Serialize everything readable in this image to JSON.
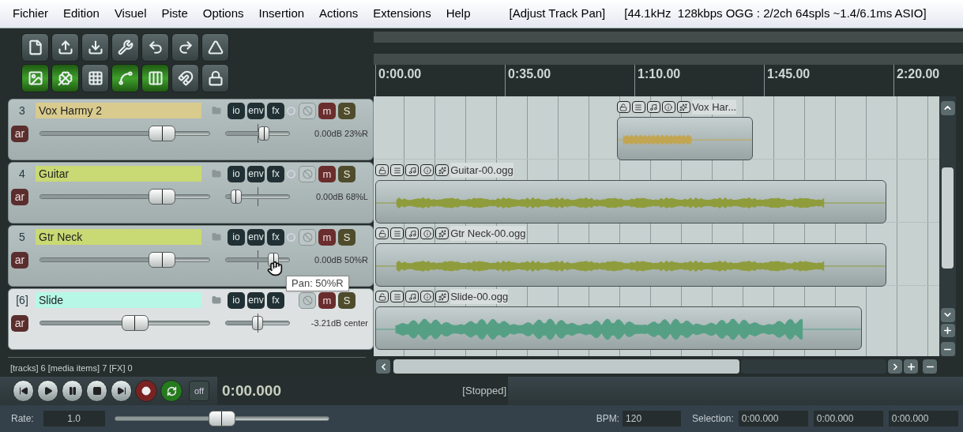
{
  "menu": [
    "Fichier",
    "Edition",
    "Visuel",
    "Piste",
    "Options",
    "Insertion",
    "Actions",
    "Extensions",
    "Help"
  ],
  "action_info": "[Adjust Track Pan]",
  "audio_info": "[44.1kHz  128kbps OGG : 2/2ch 64spls ~1.4/6.1ms ASIO]",
  "toolbar": {
    "toggles": [
      {
        "on": true
      },
      {
        "on": true
      },
      {
        "on": false
      },
      {
        "on": true
      },
      {
        "on": true
      },
      {
        "on": false
      },
      {
        "on": false
      }
    ]
  },
  "tracks": [
    {
      "number": "3",
      "name": "Vox Harmy 2",
      "color": "#d9cb8e",
      "selected": false,
      "buttons": [
        "io",
        "env",
        "fx"
      ],
      "mute": "m",
      "solo": "S",
      "arm": "ar",
      "volume": {
        "level": 0.72
      },
      "pan": {
        "level": 0.6
      },
      "reading": "0.00dB 23%R"
    },
    {
      "number": "4",
      "name": "Guitar",
      "color": "#c9d973",
      "selected": false,
      "buttons": [
        "io",
        "env",
        "fx"
      ],
      "mute": "m",
      "solo": "S",
      "arm": "ar",
      "volume": {
        "level": 0.72
      },
      "pan": {
        "level": 0.16
      },
      "reading": "0.00dB 68%L"
    },
    {
      "number": "5",
      "name": "Gtr Neck",
      "color": "#c9d973",
      "selected": false,
      "buttons": [
        "io",
        "env",
        "fx"
      ],
      "mute": "m",
      "solo": "S",
      "arm": "ar",
      "volume": {
        "level": 0.72
      },
      "pan": {
        "level": 0.75
      },
      "reading": "0.00dB 50%R"
    },
    {
      "number": "[6]",
      "name": "Slide",
      "color": "#b6f7e6",
      "selected": true,
      "buttons": [
        "io",
        "env",
        "fx"
      ],
      "mute": "m",
      "solo": "S",
      "arm": "ar",
      "volume": {
        "level": 0.56
      },
      "pan": {
        "level": 0.5
      },
      "reading": "-3.21dB center"
    }
  ],
  "tooltip": "Pan: 50%R",
  "status": "[tracks] 6 [media items] 7 [FX] 0",
  "ruler": [
    "0:00.00",
    "0:35.00",
    "1:10.00",
    "1:45.00",
    "2:20.00"
  ],
  "lanes": [
    {
      "items": [
        {
          "label": "Vox Har...",
          "color": "#c2a551"
        }
      ]
    },
    {
      "items": [
        {
          "label": "Guitar-00.ogg",
          "color": "#8f9c3c"
        }
      ]
    },
    {
      "items": [
        {
          "label": "Gtr Neck-00.ogg",
          "color": "#8f9c3c"
        }
      ]
    },
    {
      "items": [
        {
          "label": "Slide-00.ogg",
          "color": "#55a085"
        }
      ]
    }
  ],
  "transport": {
    "repeat_on": true,
    "record_armed": false,
    "off_label": "off",
    "time": "0:00.000",
    "state": "[Stopped]"
  },
  "rate": {
    "label": "Rate:",
    "value": "1.0",
    "level": 0.5
  },
  "bpm": {
    "label": "BPM:",
    "value": "120"
  },
  "selection": {
    "label": "Selection:",
    "start": "0:00.000",
    "end": "0:00.000",
    "length": "0:00.000"
  }
}
